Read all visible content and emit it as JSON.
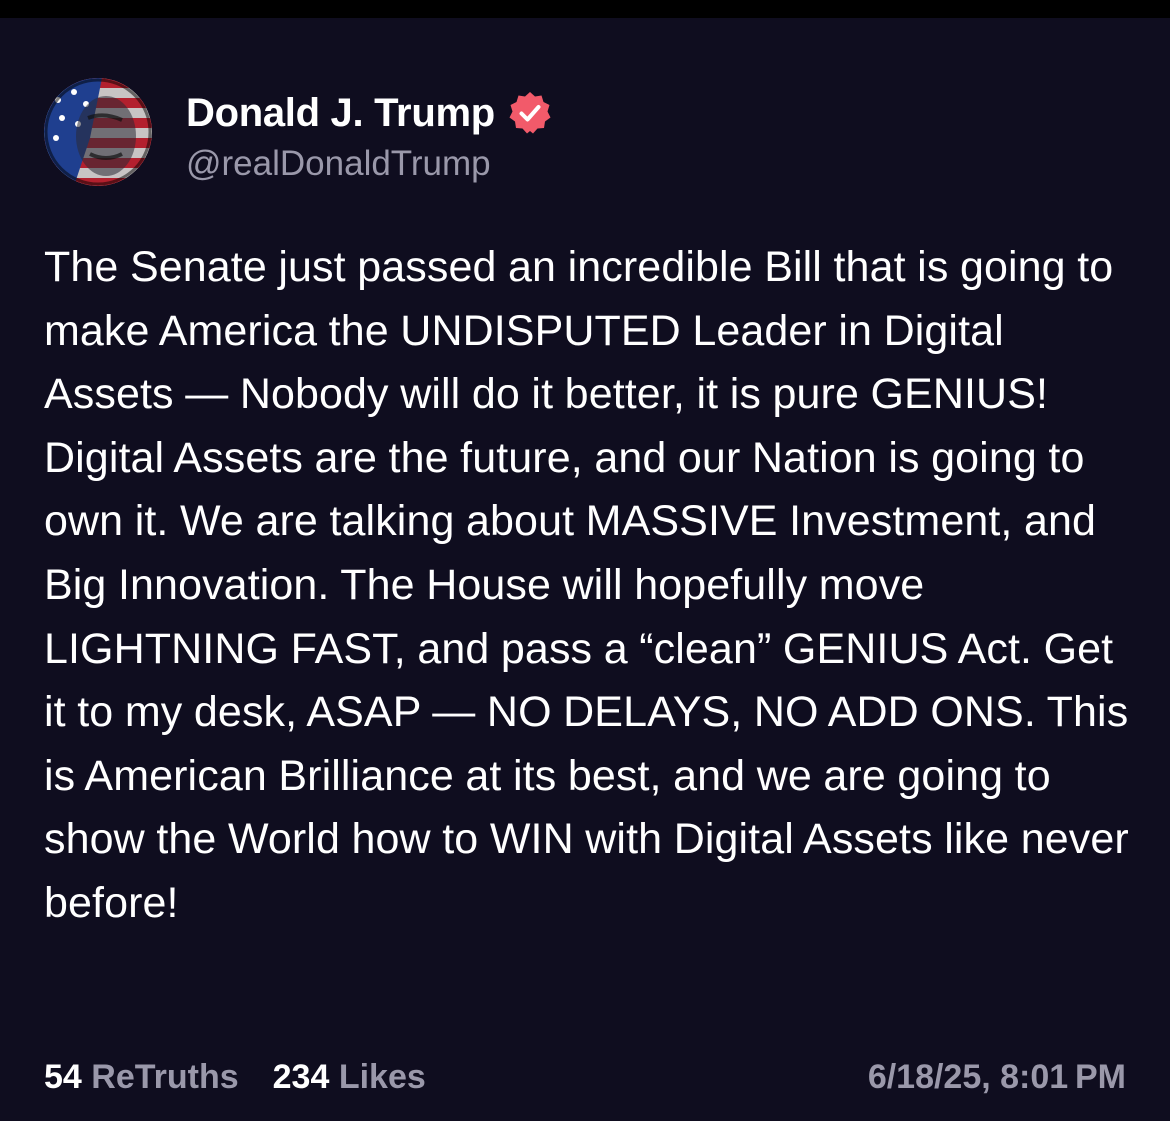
{
  "colors": {
    "background": "#0f0d1f",
    "text_primary": "#ffffff",
    "text_secondary": "#9a98aa",
    "verified_badge": "#f25a6a"
  },
  "post": {
    "author": {
      "display_name": "Donald J. Trump",
      "handle": "@realDonaldTrump",
      "verified": true,
      "verified_icon": "verified-badge-icon",
      "avatar_icon": "profile-avatar"
    },
    "body": "The Senate just passed an incredible Bill that is going to make America the UNDISPUTED Leader in Digital Assets — Nobody will do it better, it is pure GENIUS! Digital Assets are the future, and our Nation is going to own it. We are talking about MASSIVE Investment, and Big Innovation. The House will hopefully move LIGHTNING FAST, and pass a “clean” GENIUS Act. Get it to my desk, ASAP — NO DELAYS, NO ADD ONS. This is American Brilliance at its best, and we are going to show the World how to WIN with Digital Assets like never before!",
    "stats": {
      "retruths_count": "54",
      "retruths_label": "ReTruths",
      "likes_count": "234",
      "likes_label": "Likes"
    },
    "timestamp": "6/18/25, 8:01 PM"
  }
}
